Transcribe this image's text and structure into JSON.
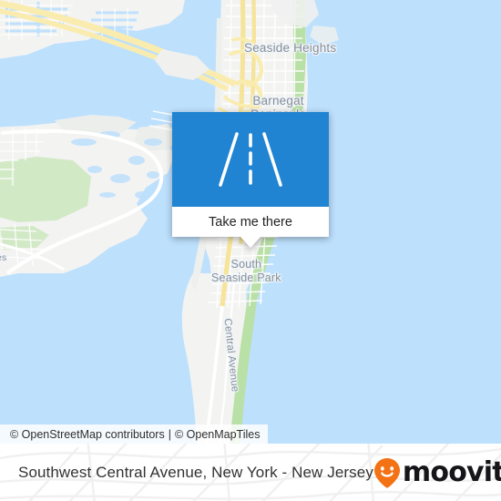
{
  "map": {
    "labels": {
      "seaside_heights": "Seaside Heights",
      "barnegat_line1": "Barnegat",
      "barnegat_line2": "Peninsula",
      "south_seaside_park_line1": "South",
      "south_seaside_park_line2": "Seaside Park",
      "central_avenue": "Central Avenue",
      "edge_left_clipped": "es"
    },
    "colors": {
      "water": "#bde0fd",
      "land": "#f2f2f1",
      "park_green": "#cfe8c4",
      "beach_green": "#b6dfa3",
      "highway_yellow": "#f8e9a6",
      "road_white": "#ffffff",
      "label_gray": "#8b8e93"
    }
  },
  "attribution": {
    "osm": "© OpenStreetMap contributors",
    "separator": "|",
    "tiles": "© OpenMapTiles"
  },
  "popup": {
    "icon": "road-icon",
    "button_label": "Take me there",
    "accent_color": "#2084d2"
  },
  "footer": {
    "title": "Southwest Central Avenue, New York - New Jersey",
    "brand": {
      "wordmark": "moovit",
      "pin_icon": "moovit-smiley-pin-icon",
      "pin_color": "#f47216"
    }
  }
}
